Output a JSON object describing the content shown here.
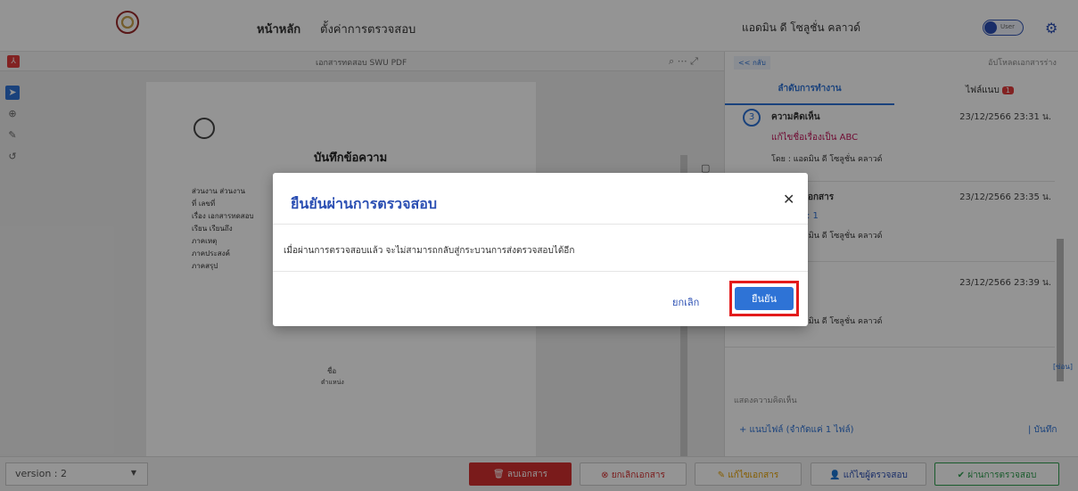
{
  "header": {
    "nav_home": "หน้าหลัก",
    "nav_settings": "ตั้งค่าการตรวจสอบ",
    "user_name": "แอดมิน ดี โซลูชั่น คลาวด์",
    "toggle_label": "User"
  },
  "pdf": {
    "title": "เอกสารทดสอบ SWU  PDF",
    "memo_heading": "บันทึกข้อความ",
    "lines": [
      "ส่วนงาน  ส่วนงาน",
      "ที่  เลขที่",
      "เรื่อง  เอกสารทดสอบ",
      "เรียน  เรียนถึง",
      "ภาคเหตุ",
      "ภาคประสงค์",
      "ภาคสรุป"
    ],
    "sign_name": "ชื่อ",
    "sign_position": "ตำแหน่ง"
  },
  "side": {
    "back": "<< กลับ",
    "upload_draft": "อัปโหลดเอกสารร่าง",
    "tab_workflow": "ลำดับการทำงาน",
    "tab_attach": "ไฟล์แนบ",
    "attach_count": "1",
    "entries": [
      {
        "num": "3",
        "title": "ความคิดเห็น",
        "date": "23/12/2566 23:31 น.",
        "detail": "แก้ไขชื่อเรื่องเป็น ABC",
        "by": "โดย : แอดมิน ดี โซลูชั่น คลาวด์"
      },
      {
        "title": "แก้ไขบนเอกสาร",
        "date": "23/12/2566 23:35 น.",
        "detail": "Version : 1",
        "by": "โดย : แอดมิน ดี โซลูชั่น คลาวด์"
      },
      {
        "title": "เอกสาร",
        "date": "23/12/2566 23:39 น.",
        "detail": "2",
        "by": "โดย : แอดมิน ดี โซลูชั่น คลาวด์"
      }
    ],
    "hide": "[ซ่อน]",
    "comment_placeholder": "แสดงความคิดเห็น",
    "attach_file": "+ แนบไฟล์ (จำกัดแค่ 1 ไฟล์)",
    "save": "| บันทึก"
  },
  "bottom": {
    "version": "version : 2",
    "delete_doc": "ลบเอกสาร",
    "cancel_doc": "ยกเลิกเอกสาร",
    "edit_doc": "แก้ไขเอกสาร",
    "edit_reviewer": "แก้ไขผู้ตรวจสอบ",
    "pass_review": "ผ่านการตรวจสอบ"
  },
  "modal": {
    "title": "ยืนยันผ่านการตรวจสอบ",
    "message": "เมื่อผ่านการตรวจสอบแล้ว จะไม่สามารถกลับสู่กระบวนการส่งตรวจสอบได้อีก",
    "cancel": "ยกเลิก",
    "confirm": "ยืนยัน"
  },
  "colors": {
    "accent": "#2e73d6",
    "title_blue": "#2b4fb3",
    "highlight": "#e31b1b",
    "danger": "#d32f2f",
    "success": "#2e9e4e"
  }
}
